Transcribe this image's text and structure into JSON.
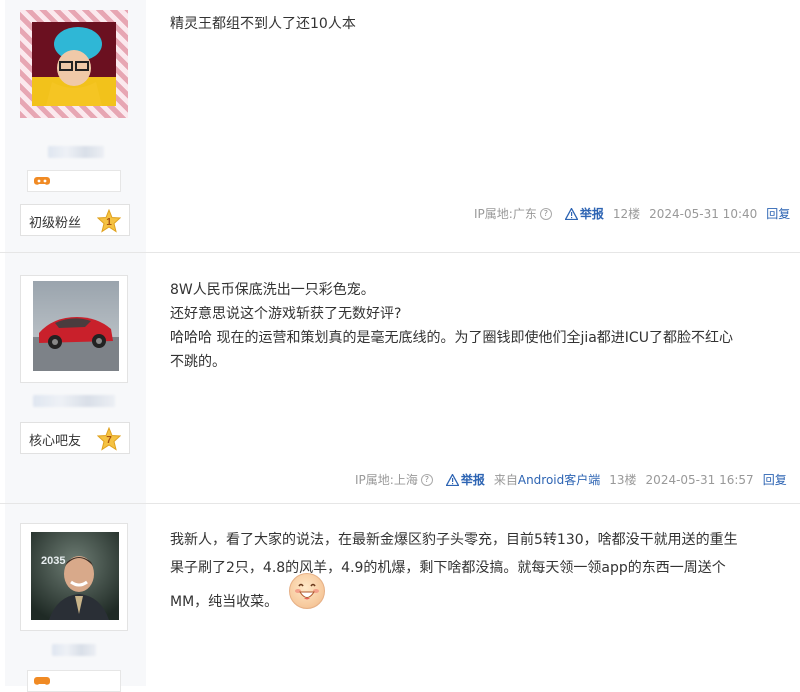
{
  "posts": [
    {
      "content_lines": [
        "精灵王都组不到人了还10人本"
      ],
      "level_label": "初级粉丝",
      "level_num": "1",
      "ip": "IP属地:广东",
      "report": "举报",
      "floor": "12楼",
      "time": "2024-05-31 10:40",
      "reply": "回复"
    },
    {
      "content_lines": [
        "8W人民币保底洗出一只彩色宠。",
        "还好意思说这个游戏斩获了无数好评?",
        "哈哈哈 现在的运营和策划真的是毫无底线的。为了圈钱即使他们全jia都进ICU了都脸不红心",
        "不跳的。"
      ],
      "level_label": "核心吧友",
      "level_num": "7",
      "ip": "IP属地:上海",
      "report": "举报",
      "source_prefix": "来自",
      "source_link": "Android客户端",
      "floor": "13楼",
      "time": "2024-05-31 16:57",
      "reply": "回复"
    },
    {
      "content_lines": [
        "我新人，看了大家的说法，在最新金爆区豹子头零充，目前5转130，啥都没干就用送的重生",
        "果子刷了2只，4.8的风羊，4.9的机爆，剩下啥都没搞。就每天领一领app的东西一周送个",
        "MM，纯当收菜。"
      ],
      "avatar_text": "2035"
    }
  ],
  "colors": {
    "link": "#2d64b3",
    "meta": "#999999",
    "sidebar": "#f7f8fa",
    "star": "#f5c242"
  }
}
